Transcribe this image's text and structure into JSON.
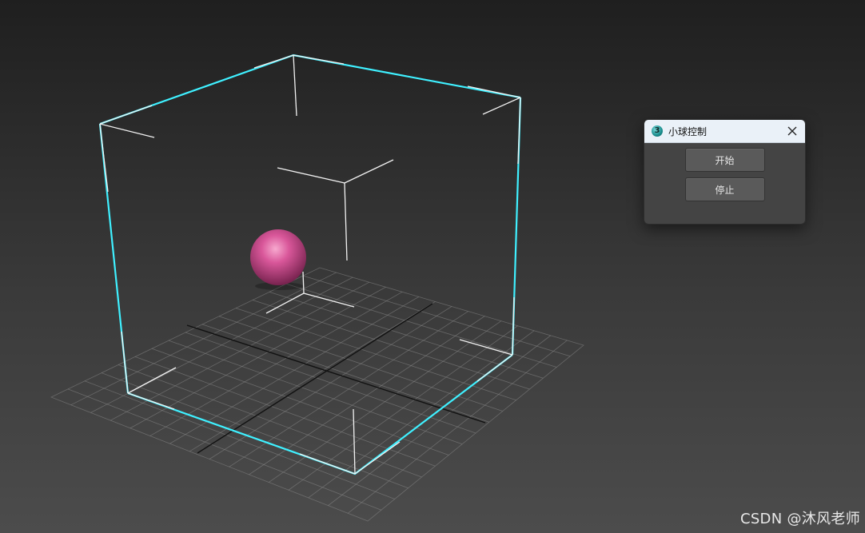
{
  "dialog": {
    "title": "小球控制",
    "app_icon_glyph": "3",
    "close_icon": "close-icon",
    "start_label": "开始",
    "stop_label": "停止"
  },
  "watermark": {
    "text": "CSDN @沐风老师"
  },
  "scene": {
    "box_highlight_color": "#3ff0ff",
    "sphere_color": "#d9579a",
    "grid_color": "#8a8a8a",
    "axis_color": "#111111"
  }
}
